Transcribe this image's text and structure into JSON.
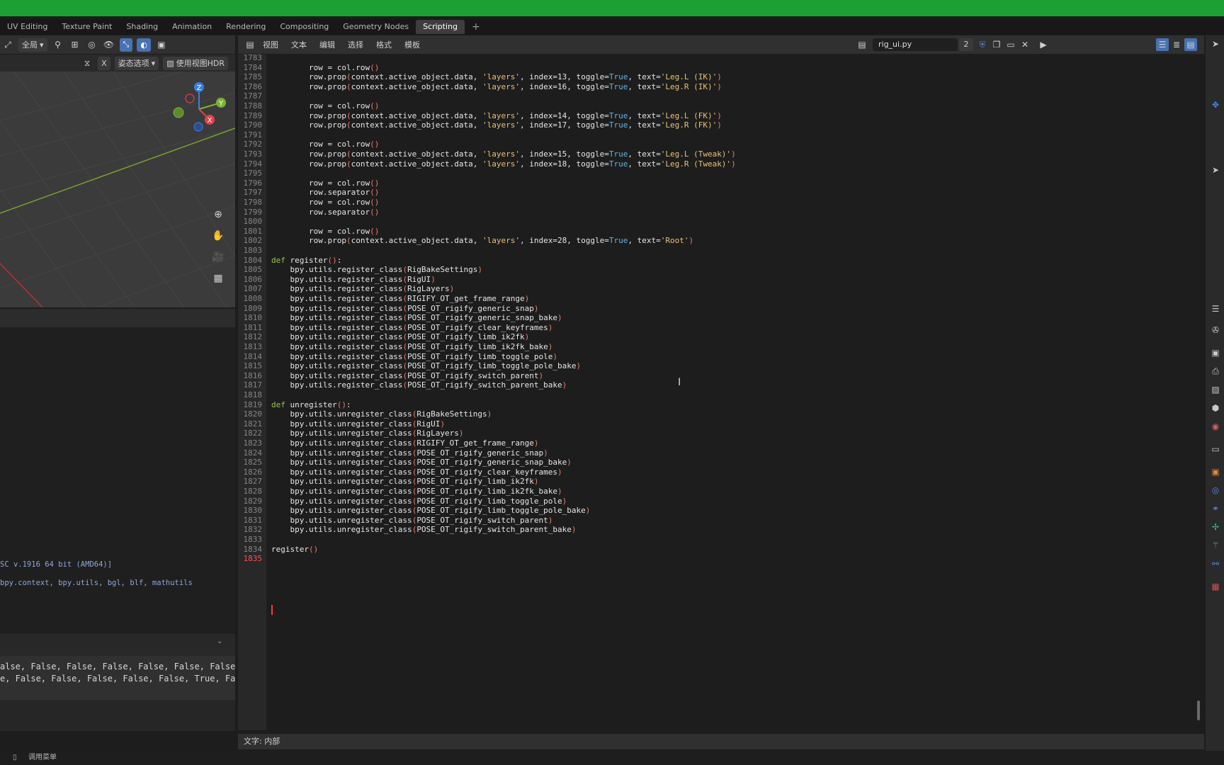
{
  "workspace_tabs": [
    {
      "label": "UV Editing"
    },
    {
      "label": "Texture Paint"
    },
    {
      "label": "Shading"
    },
    {
      "label": "Animation"
    },
    {
      "label": "Rendering"
    },
    {
      "label": "Compositing"
    },
    {
      "label": "Geometry Nodes"
    },
    {
      "label": "Scripting",
      "active": true
    }
  ],
  "add_tab": "+",
  "viewport": {
    "view_mode": "全局",
    "pose_options": "姿态选项",
    "hdr_toggle": "使用视图HDR",
    "x_label": "X",
    "gizmo": {
      "z": "Z",
      "y": "Y",
      "x": "X"
    }
  },
  "console_lines": [
    "SC v.1916 64 bit (AMD64)]",
    "  bpy.context, bpy.utils, bgl, blf, mathutils"
  ],
  "info_lines": [
    "alse, False, False, False, False, False, False",
    "e, False, False, False, False, False, True, Fa"
  ],
  "text_editor": {
    "menu": [
      "视图",
      "文本",
      "编辑",
      "选择",
      "格式",
      "模板"
    ],
    "file_name": "rig_ui.py",
    "user_count": "2",
    "footer": "文字: 内部"
  },
  "code_lines": [
    {
      "n": "1783",
      "t": ""
    },
    {
      "n": "1784",
      "t": "        row = col.row()"
    },
    {
      "n": "1785",
      "t": "        row.prop(context.active_object.data, 'layers', index=13, toggle=True, text='Leg.L (IK)')"
    },
    {
      "n": "1786",
      "t": "        row.prop(context.active_object.data, 'layers', index=16, toggle=True, text='Leg.R (IK)')"
    },
    {
      "n": "1787",
      "t": ""
    },
    {
      "n": "1788",
      "t": "        row = col.row()"
    },
    {
      "n": "1789",
      "t": "        row.prop(context.active_object.data, 'layers', index=14, toggle=True, text='Leg.L (FK)')"
    },
    {
      "n": "1790",
      "t": "        row.prop(context.active_object.data, 'layers', index=17, toggle=True, text='Leg.R (FK)')"
    },
    {
      "n": "1791",
      "t": ""
    },
    {
      "n": "1792",
      "t": "        row = col.row()"
    },
    {
      "n": "1793",
      "t": "        row.prop(context.active_object.data, 'layers', index=15, toggle=True, text='Leg.L (Tweak)')"
    },
    {
      "n": "1794",
      "t": "        row.prop(context.active_object.data, 'layers', index=18, toggle=True, text='Leg.R (Tweak)')"
    },
    {
      "n": "1795",
      "t": ""
    },
    {
      "n": "1796",
      "t": "        row = col.row()"
    },
    {
      "n": "1797",
      "t": "        row.separator()"
    },
    {
      "n": "1798",
      "t": "        row = col.row()"
    },
    {
      "n": "1799",
      "t": "        row.separator()"
    },
    {
      "n": "1800",
      "t": ""
    },
    {
      "n": "1801",
      "t": "        row = col.row()"
    },
    {
      "n": "1802",
      "t": "        row.prop(context.active_object.data, 'layers', index=28, toggle=True, text='Root')"
    },
    {
      "n": "1803",
      "t": ""
    },
    {
      "n": "1804",
      "t": "def register():"
    },
    {
      "n": "1805",
      "t": "    bpy.utils.register_class(RigBakeSettings)"
    },
    {
      "n": "1806",
      "t": "    bpy.utils.register_class(RigUI)"
    },
    {
      "n": "1807",
      "t": "    bpy.utils.register_class(RigLayers)"
    },
    {
      "n": "1808",
      "t": "    bpy.utils.register_class(RIGIFY_OT_get_frame_range)"
    },
    {
      "n": "1809",
      "t": "    bpy.utils.register_class(POSE_OT_rigify_generic_snap)"
    },
    {
      "n": "1810",
      "t": "    bpy.utils.register_class(POSE_OT_rigify_generic_snap_bake)"
    },
    {
      "n": "1811",
      "t": "    bpy.utils.register_class(POSE_OT_rigify_clear_keyframes)"
    },
    {
      "n": "1812",
      "t": "    bpy.utils.register_class(POSE_OT_rigify_limb_ik2fk)"
    },
    {
      "n": "1813",
      "t": "    bpy.utils.register_class(POSE_OT_rigify_limb_ik2fk_bake)"
    },
    {
      "n": "1814",
      "t": "    bpy.utils.register_class(POSE_OT_rigify_limb_toggle_pole)"
    },
    {
      "n": "1815",
      "t": "    bpy.utils.register_class(POSE_OT_rigify_limb_toggle_pole_bake)"
    },
    {
      "n": "1816",
      "t": "    bpy.utils.register_class(POSE_OT_rigify_switch_parent)"
    },
    {
      "n": "1817",
      "t": "    bpy.utils.register_class(POSE_OT_rigify_switch_parent_bake)"
    },
    {
      "n": "1818",
      "t": ""
    },
    {
      "n": "1819",
      "t": "def unregister():"
    },
    {
      "n": "1820",
      "t": "    bpy.utils.unregister_class(RigBakeSettings)"
    },
    {
      "n": "1821",
      "t": "    bpy.utils.unregister_class(RigUI)"
    },
    {
      "n": "1822",
      "t": "    bpy.utils.unregister_class(RigLayers)"
    },
    {
      "n": "1823",
      "t": "    bpy.utils.unregister_class(RIGIFY_OT_get_frame_range)"
    },
    {
      "n": "1824",
      "t": "    bpy.utils.unregister_class(POSE_OT_rigify_generic_snap)"
    },
    {
      "n": "1825",
      "t": "    bpy.utils.unregister_class(POSE_OT_rigify_generic_snap_bake)"
    },
    {
      "n": "1826",
      "t": "    bpy.utils.unregister_class(POSE_OT_rigify_clear_keyframes)"
    },
    {
      "n": "1827",
      "t": "    bpy.utils.unregister_class(POSE_OT_rigify_limb_ik2fk)"
    },
    {
      "n": "1828",
      "t": "    bpy.utils.unregister_class(POSE_OT_rigify_limb_ik2fk_bake)"
    },
    {
      "n": "1829",
      "t": "    bpy.utils.unregister_class(POSE_OT_rigify_limb_toggle_pole)"
    },
    {
      "n": "1830",
      "t": "    bpy.utils.unregister_class(POSE_OT_rigify_limb_toggle_pole_bake)"
    },
    {
      "n": "1831",
      "t": "    bpy.utils.unregister_class(POSE_OT_rigify_switch_parent)"
    },
    {
      "n": "1832",
      "t": "    bpy.utils.unregister_class(POSE_OT_rigify_switch_parent_bake)"
    },
    {
      "n": "1833",
      "t": ""
    },
    {
      "n": "1834",
      "t": "register()"
    },
    {
      "n": "1835",
      "t": "",
      "current": true
    }
  ],
  "status_bar": {
    "hint": "调用菜单"
  },
  "colors": {
    "accent": "#4772b3",
    "top_bar": "#1ca033",
    "keyword": "#97c64b",
    "string": "#e8c07a",
    "builtin": "#5fb4e6",
    "paren": "#e97b6a",
    "cursor": "#ff3838"
  }
}
